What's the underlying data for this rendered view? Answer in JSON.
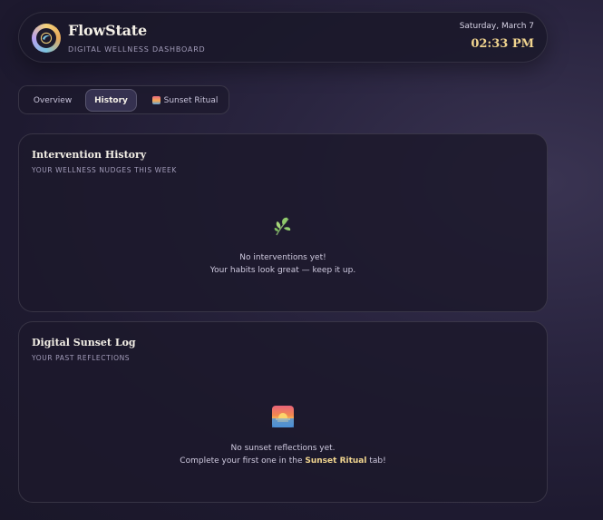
{
  "header": {
    "title": "FlowState",
    "subtitle": "DIGITAL WELLNESS DASHBOARD",
    "date": "Saturday, March 7",
    "time": "02:33 PM",
    "logo_icon": "flow-logo-icon"
  },
  "tabs": [
    {
      "label": "Overview",
      "active": false
    },
    {
      "label": "History",
      "active": true
    },
    {
      "label": "Sunset Ritual",
      "active": false,
      "icon": "sunset-icon"
    }
  ],
  "history": {
    "title": "Intervention History",
    "subtitle": "YOUR WELLNESS NUDGES THIS WEEK",
    "icon": "leaf-icon",
    "empty_line1": "No interventions yet!",
    "empty_line2": "Your habits look great — keep it up."
  },
  "sunset_log": {
    "title": "Digital Sunset Log",
    "subtitle": "YOUR PAST REFLECTIONS",
    "icon": "sunset-icon",
    "empty_line1": "No sunset reflections yet.",
    "empty_line2_prefix": "Complete your first one in the ",
    "empty_line2_link": "Sunset Ritual",
    "empty_line2_suffix": " tab!"
  },
  "colors": {
    "accent_gold": "#f1d58f",
    "background": "#1e1a30",
    "card": "#1c192b"
  }
}
